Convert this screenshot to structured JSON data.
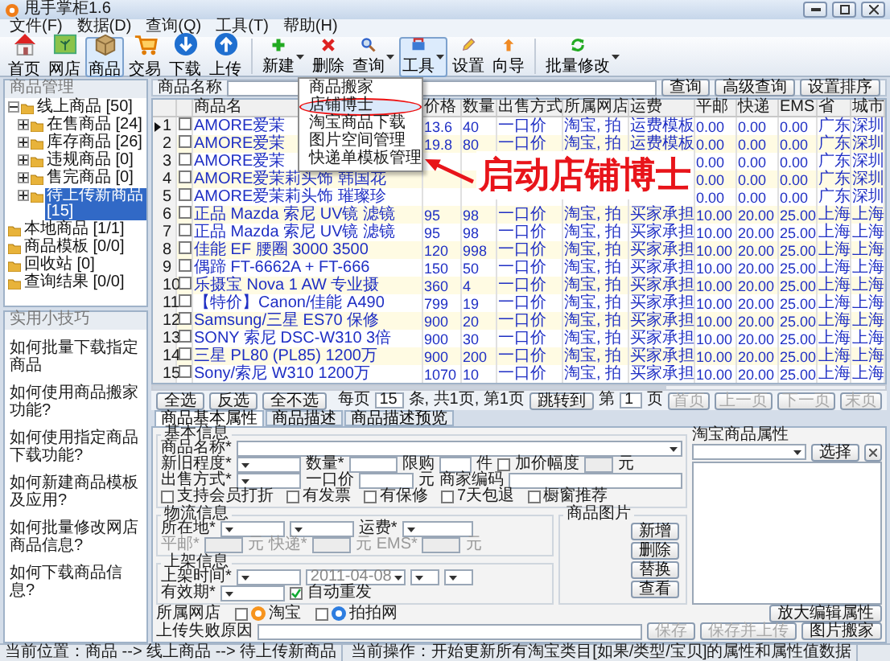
{
  "window": {
    "title": "甩手掌柜1.6"
  },
  "menu": [
    "文件(F)",
    "数据(D)",
    "查询(Q)",
    "工具(T)",
    "帮助(H)"
  ],
  "toolbar": [
    {
      "items": [
        {
          "label": "首页",
          "selected": false,
          "dropdown": false
        },
        {
          "label": "网店",
          "selected": false,
          "dropdown": false
        },
        {
          "label": "商品",
          "selected": true,
          "dropdown": false
        },
        {
          "label": "交易",
          "selected": false,
          "dropdown": false
        },
        {
          "label": "下载",
          "selected": false,
          "dropdown": false
        },
        {
          "label": "上传",
          "selected": false,
          "dropdown": false
        }
      ]
    },
    {
      "items": [
        {
          "label": "新建",
          "selected": false,
          "dropdown": true
        },
        {
          "label": "删除",
          "selected": false,
          "dropdown": false
        },
        {
          "label": "查询",
          "selected": false,
          "dropdown": true
        },
        {
          "label": "工具",
          "selected": true,
          "dropdown": true,
          "menu": [
            {
              "label": "商品搬家",
              "selected": false
            },
            {
              "label": "店铺博士",
              "selected": true
            },
            {
              "label": "淘宝商品下载",
              "selected": false
            },
            {
              "label": "图片空间管理",
              "selected": false
            },
            {
              "label": "快递单模板管理",
              "selected": false
            }
          ]
        },
        {
          "label": "设置",
          "selected": false,
          "dropdown": false
        },
        {
          "label": "向导",
          "selected": false,
          "dropdown": false
        }
      ]
    },
    {
      "items": [
        {
          "label": "批量修改",
          "selected": false,
          "dropdown": true
        }
      ]
    }
  ],
  "callout": {
    "text": "启动店铺博士"
  },
  "sidebar": {
    "title": "商品管理",
    "tree": [
      {
        "label": "线上商品 [50]",
        "selected": false,
        "expanded": true,
        "children": [
          {
            "label": "在售商品 [24]",
            "selected": false,
            "expanded": false
          },
          {
            "label": "库存商品 [26]",
            "selected": false,
            "expanded": false
          },
          {
            "label": "违规商品 [0]",
            "selected": false,
            "expanded": false
          },
          {
            "label": "售完商品 [0]",
            "selected": false,
            "expanded": false
          },
          {
            "label": "待上传新商品 [15]",
            "selected": true,
            "expanded": false
          }
        ]
      },
      {
        "label": "本地商品 [1/1]",
        "selected": false
      },
      {
        "label": "商品模板 [0/0]",
        "selected": false
      },
      {
        "label": "回收站 [0]",
        "selected": false
      },
      {
        "label": "查询结果 [0/0]",
        "selected": false
      }
    ]
  },
  "tips": {
    "title": "实用小技巧",
    "items": [
      "如何批量下载指定商品",
      "如何使用商品搬家功能?",
      "如何使用指定商品下载功能?",
      "如何新建商品模板及应用?",
      "如何批量修改网店商品信息?",
      "如何下载商品信息?"
    ]
  },
  "search": {
    "label": "商品名称",
    "buttons": [
      "查询",
      "高级查询"
    ],
    "sort_button": "设置排序"
  },
  "table": {
    "columns": [
      "商品名",
      "价格",
      "数量",
      "出售方式",
      "所属网店",
      "运费",
      "平邮",
      "快递",
      "EMS",
      "省",
      "城市"
    ],
    "rows": [
      {
        "index": "1",
        "current": true,
        "checked": false,
        "cells": [
          "AMORE爱茉",
          "13.6",
          "40",
          "一口价",
          "淘宝, 拍",
          "运费模板",
          "0.00",
          "0.00",
          "0.00",
          "广东",
          "深圳"
        ]
      },
      {
        "index": "2",
        "current": false,
        "checked": false,
        "cells": [
          "AMORE爱茉",
          "19.8",
          "80",
          "一口价",
          "淘宝, 拍",
          "运费模板",
          "0.00",
          "0.00",
          "0.00",
          "广东",
          "深圳"
        ]
      },
      {
        "index": "3",
        "current": false,
        "checked": false,
        "cells": [
          "AMORE爱茉",
          null,
          null,
          null,
          null,
          null,
          "0.00",
          "0.00",
          "0.00",
          "广东",
          "深圳"
        ]
      },
      {
        "index": "4",
        "current": false,
        "checked": false,
        "cells": [
          "AMORE爱茉莉头饰 韩国花",
          null,
          null,
          null,
          null,
          null,
          "0.00",
          "0.00",
          "0.00",
          "广东",
          "深圳"
        ]
      },
      {
        "index": "5",
        "current": false,
        "checked": false,
        "cells": [
          "AMORE爱茉莉头饰 璀璨珍",
          null,
          null,
          null,
          null,
          null,
          "0.00",
          "0.00",
          "0.00",
          "广东",
          "深圳"
        ]
      },
      {
        "index": "6",
        "current": false,
        "checked": false,
        "cells": [
          "正品 Mazda 索尼 UV镜 滤镜",
          "95",
          "98",
          "一口价",
          "淘宝, 拍",
          "买家承担",
          "10.00",
          "20.00",
          "25.00",
          "上海",
          "上海"
        ]
      },
      {
        "index": "7",
        "current": false,
        "checked": false,
        "cells": [
          "正品 Mazda 索尼 UV镜 滤镜",
          "95",
          "98",
          "一口价",
          "淘宝, 拍",
          "买家承担",
          "10.00",
          "20.00",
          "25.00",
          "上海",
          "上海"
        ]
      },
      {
        "index": "8",
        "current": false,
        "checked": false,
        "cells": [
          "佳能 EF 腰圈 3000 3500",
          "120",
          "998",
          "一口价",
          "淘宝, 拍",
          "买家承担",
          "10.00",
          "20.00",
          "25.00",
          "上海",
          "上海"
        ]
      },
      {
        "index": "9",
        "current": false,
        "checked": false,
        "cells": [
          "偶蹄 FT-6662A + FT-666",
          "150",
          "50",
          "一口价",
          "淘宝, 拍",
          "买家承担",
          "10.00",
          "20.00",
          "25.00",
          "上海",
          "上海"
        ]
      },
      {
        "index": "10",
        "current": false,
        "checked": false,
        "cells": [
          "乐摄宝 Nova 1 AW 专业摄",
          "360",
          "4",
          "一口价",
          "淘宝, 拍",
          "买家承担",
          "10.00",
          "20.00",
          "25.00",
          "上海",
          "上海"
        ]
      },
      {
        "index": "11",
        "current": false,
        "checked": false,
        "cells": [
          "【特价】Canon/佳能 A490",
          "799",
          "19",
          "一口价",
          "淘宝, 拍",
          "买家承担",
          "10.00",
          "20.00",
          "25.00",
          "上海",
          "上海"
        ]
      },
      {
        "index": "12",
        "current": false,
        "checked": false,
        "cells": [
          "Samsung/三星 ES70 保修",
          "900",
          "20",
          "一口价",
          "淘宝, 拍",
          "买家承担",
          "10.00",
          "20.00",
          "25.00",
          "上海",
          "上海"
        ]
      },
      {
        "index": "13",
        "current": false,
        "checked": false,
        "cells": [
          "SONY 索尼 DSC-W310 3倍",
          "900",
          "30",
          "一口价",
          "淘宝, 拍",
          "买家承担",
          "10.00",
          "20.00",
          "25.00",
          "上海",
          "上海"
        ]
      },
      {
        "index": "14",
        "current": false,
        "checked": false,
        "cells": [
          "三星 PL80 (PL85) 1200万",
          "900",
          "200",
          "一口价",
          "淘宝, 拍",
          "买家承担",
          "10.00",
          "20.00",
          "25.00",
          "上海",
          "上海"
        ]
      },
      {
        "index": "15",
        "current": false,
        "checked": false,
        "cells": [
          "Sony/索尼 W310 1200万",
          "1070",
          "10",
          "一口价",
          "淘宝, 拍",
          "买家承担",
          "10.00",
          "20.00",
          "25.00",
          "上海",
          "上海"
        ]
      }
    ]
  },
  "pager": {
    "buttons": [
      "全选",
      "反选",
      "全不选"
    ],
    "per_page_label": "每页",
    "per_page": "15",
    "summary": "条, 共1页, 第1页",
    "jump": "跳转到",
    "page_prefix": "第",
    "page": "1",
    "page_suffix": "页",
    "nav": [
      {
        "label": "首页",
        "disabled": true
      },
      {
        "label": "上一页",
        "disabled": true
      },
      {
        "label": "下一页",
        "disabled": true
      },
      {
        "label": "末页",
        "disabled": true
      }
    ]
  },
  "form": {
    "tabs": [
      {
        "label": "商品基本属性",
        "selected": true
      },
      {
        "label": "商品描述",
        "selected": false
      },
      {
        "label": "商品描述预览",
        "selected": false
      }
    ],
    "basic": {
      "title": "基本信息",
      "name_label": "商品名称*",
      "condition_label": "新旧程度*",
      "qty_label": "数量*",
      "limit_label": "限购",
      "limit_unit": "件",
      "markup": {
        "label": "加价幅度",
        "checked": false
      },
      "markup_unit": "元",
      "sale_label": "出售方式*",
      "fixed_label": "一口价",
      "fixed_unit": "元",
      "code_label": "商家编码",
      "options": [
        {
          "label": "支持会员打折",
          "checked": false
        },
        {
          "label": "有发票",
          "checked": false
        },
        {
          "label": "有保修",
          "checked": false
        },
        {
          "label": "7天包退",
          "checked": false
        },
        {
          "label": "橱窗推荐",
          "checked": false
        }
      ]
    },
    "logistics": {
      "title": "物流信息",
      "location_label": "所在地*",
      "freight_label": "运费*",
      "fees": [
        {
          "label": "平邮*",
          "unit": "元",
          "disabled": true
        },
        {
          "label": "快递*",
          "unit": "元",
          "disabled": true
        },
        {
          "label": "EMS*",
          "unit": "元",
          "disabled": true
        }
      ]
    },
    "shelf": {
      "title": "上架信息",
      "time_label": "上架时间*",
      "date": "2011-04-08",
      "period_label": "有效期*",
      "autorelist": {
        "label": "自动重发",
        "checked": true
      }
    },
    "pictures": {
      "title": "商品图片",
      "buttons": [
        "新增",
        "删除",
        "替换",
        "查看"
      ]
    },
    "attributes": {
      "title": "淘宝商品属性",
      "choose": "选择",
      "enlarge": "放大编辑属性"
    },
    "shops": {
      "label": "所属网店",
      "items": [
        {
          "label": "淘宝",
          "checked": false
        },
        {
          "label": "拍拍网",
          "checked": false
        }
      ]
    },
    "fail": {
      "label": "上传失败原因"
    },
    "actions": [
      {
        "label": "保存",
        "disabled": true
      },
      {
        "label": "保存并上传",
        "disabled": true
      },
      {
        "label": "图片搬家",
        "disabled": false
      }
    ]
  },
  "status_bar": [
    "当前位置：商品 --> 线上商品 --> 待上传新商品",
    "当前操作：开始更新所有淘宝类目[如果/类型/宝贝]的属性和属性值数据"
  ]
}
